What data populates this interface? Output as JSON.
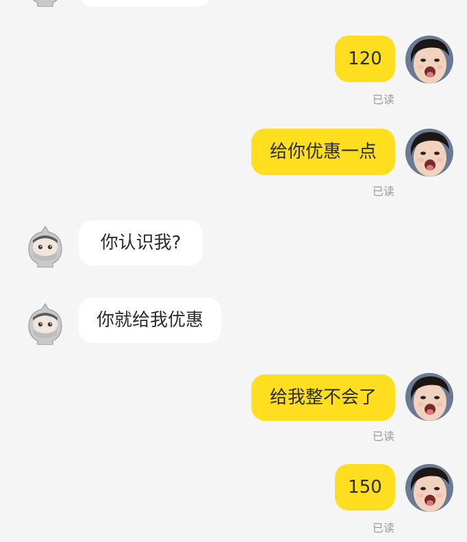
{
  "colors": {
    "background": "#f5f5f5",
    "my_bubble": "#ffdd1f",
    "other_bubble": "#ffffff",
    "read_status": "#9a9a9a"
  },
  "icons": {
    "me_avatar": "child-face-avatar-icon",
    "other_avatar": "gray-hooded-character-avatar-icon"
  },
  "chat": {
    "messages": [
      {
        "sender": "me",
        "text": "120",
        "status": "已读"
      },
      {
        "sender": "me",
        "text": "给你优惠一点",
        "status": "已读"
      },
      {
        "sender": "other",
        "text": "你认识我?"
      },
      {
        "sender": "other",
        "text": "你就给我优惠"
      },
      {
        "sender": "me",
        "text": "给我整不会了",
        "status": "已读"
      },
      {
        "sender": "me",
        "text": "150",
        "status": "已读"
      }
    ]
  }
}
